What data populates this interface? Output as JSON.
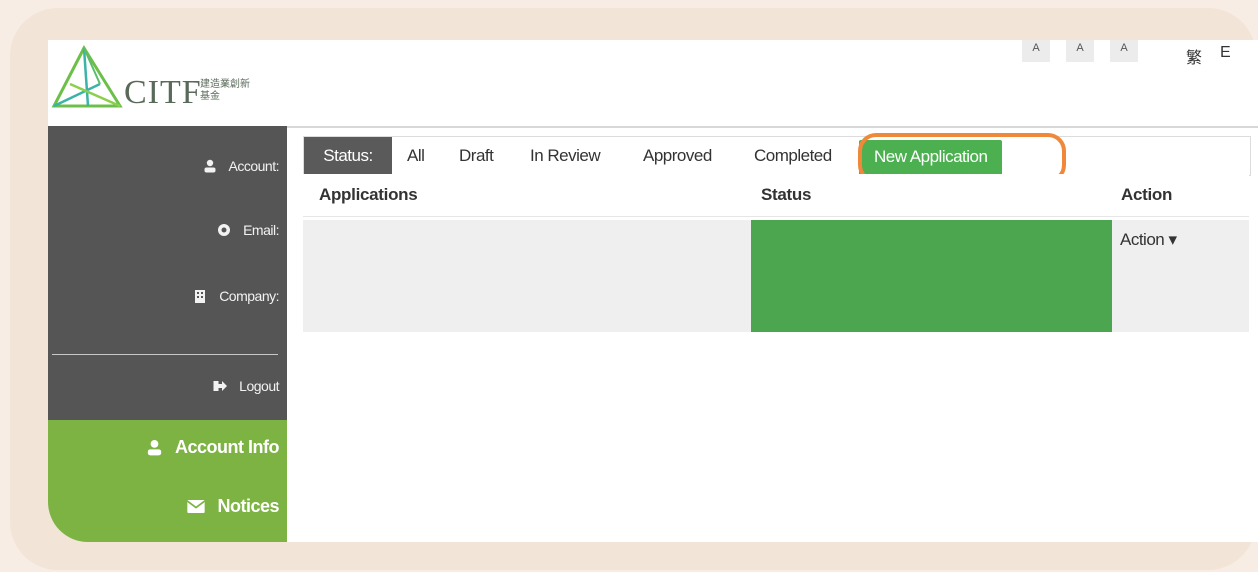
{
  "header": {
    "logo_text": "CITF",
    "logo_cn": "建造業創新基金",
    "font_sizes": [
      "A",
      "A",
      "A"
    ],
    "lang": [
      "繁",
      "E"
    ]
  },
  "sidebar": {
    "items": [
      {
        "label": "Account:",
        "icon": "user-icon"
      },
      {
        "label": "Email:",
        "icon": "at-icon"
      },
      {
        "label": "Company:",
        "icon": "building-icon"
      },
      {
        "label": "Logout",
        "icon": "logout-icon"
      }
    ],
    "nav": [
      {
        "label": "Account Info",
        "icon": "user-icon"
      },
      {
        "label": "Notices",
        "icon": "envelope-icon"
      }
    ]
  },
  "tabs": {
    "status_label": "Status:",
    "items": [
      "All",
      "Draft",
      "In Review",
      "Approved",
      "Completed"
    ],
    "new_application": "New Application"
  },
  "table": {
    "headers": [
      "Applications",
      "Status",
      "Action"
    ],
    "rows": [
      {
        "application": "",
        "status": "",
        "action": "Action ▾"
      }
    ]
  },
  "colors": {
    "accent_green": "#4caf50",
    "sidebar_green": "#7cb342",
    "sidebar_dark": "#555555",
    "highlight": "#f0883a"
  }
}
